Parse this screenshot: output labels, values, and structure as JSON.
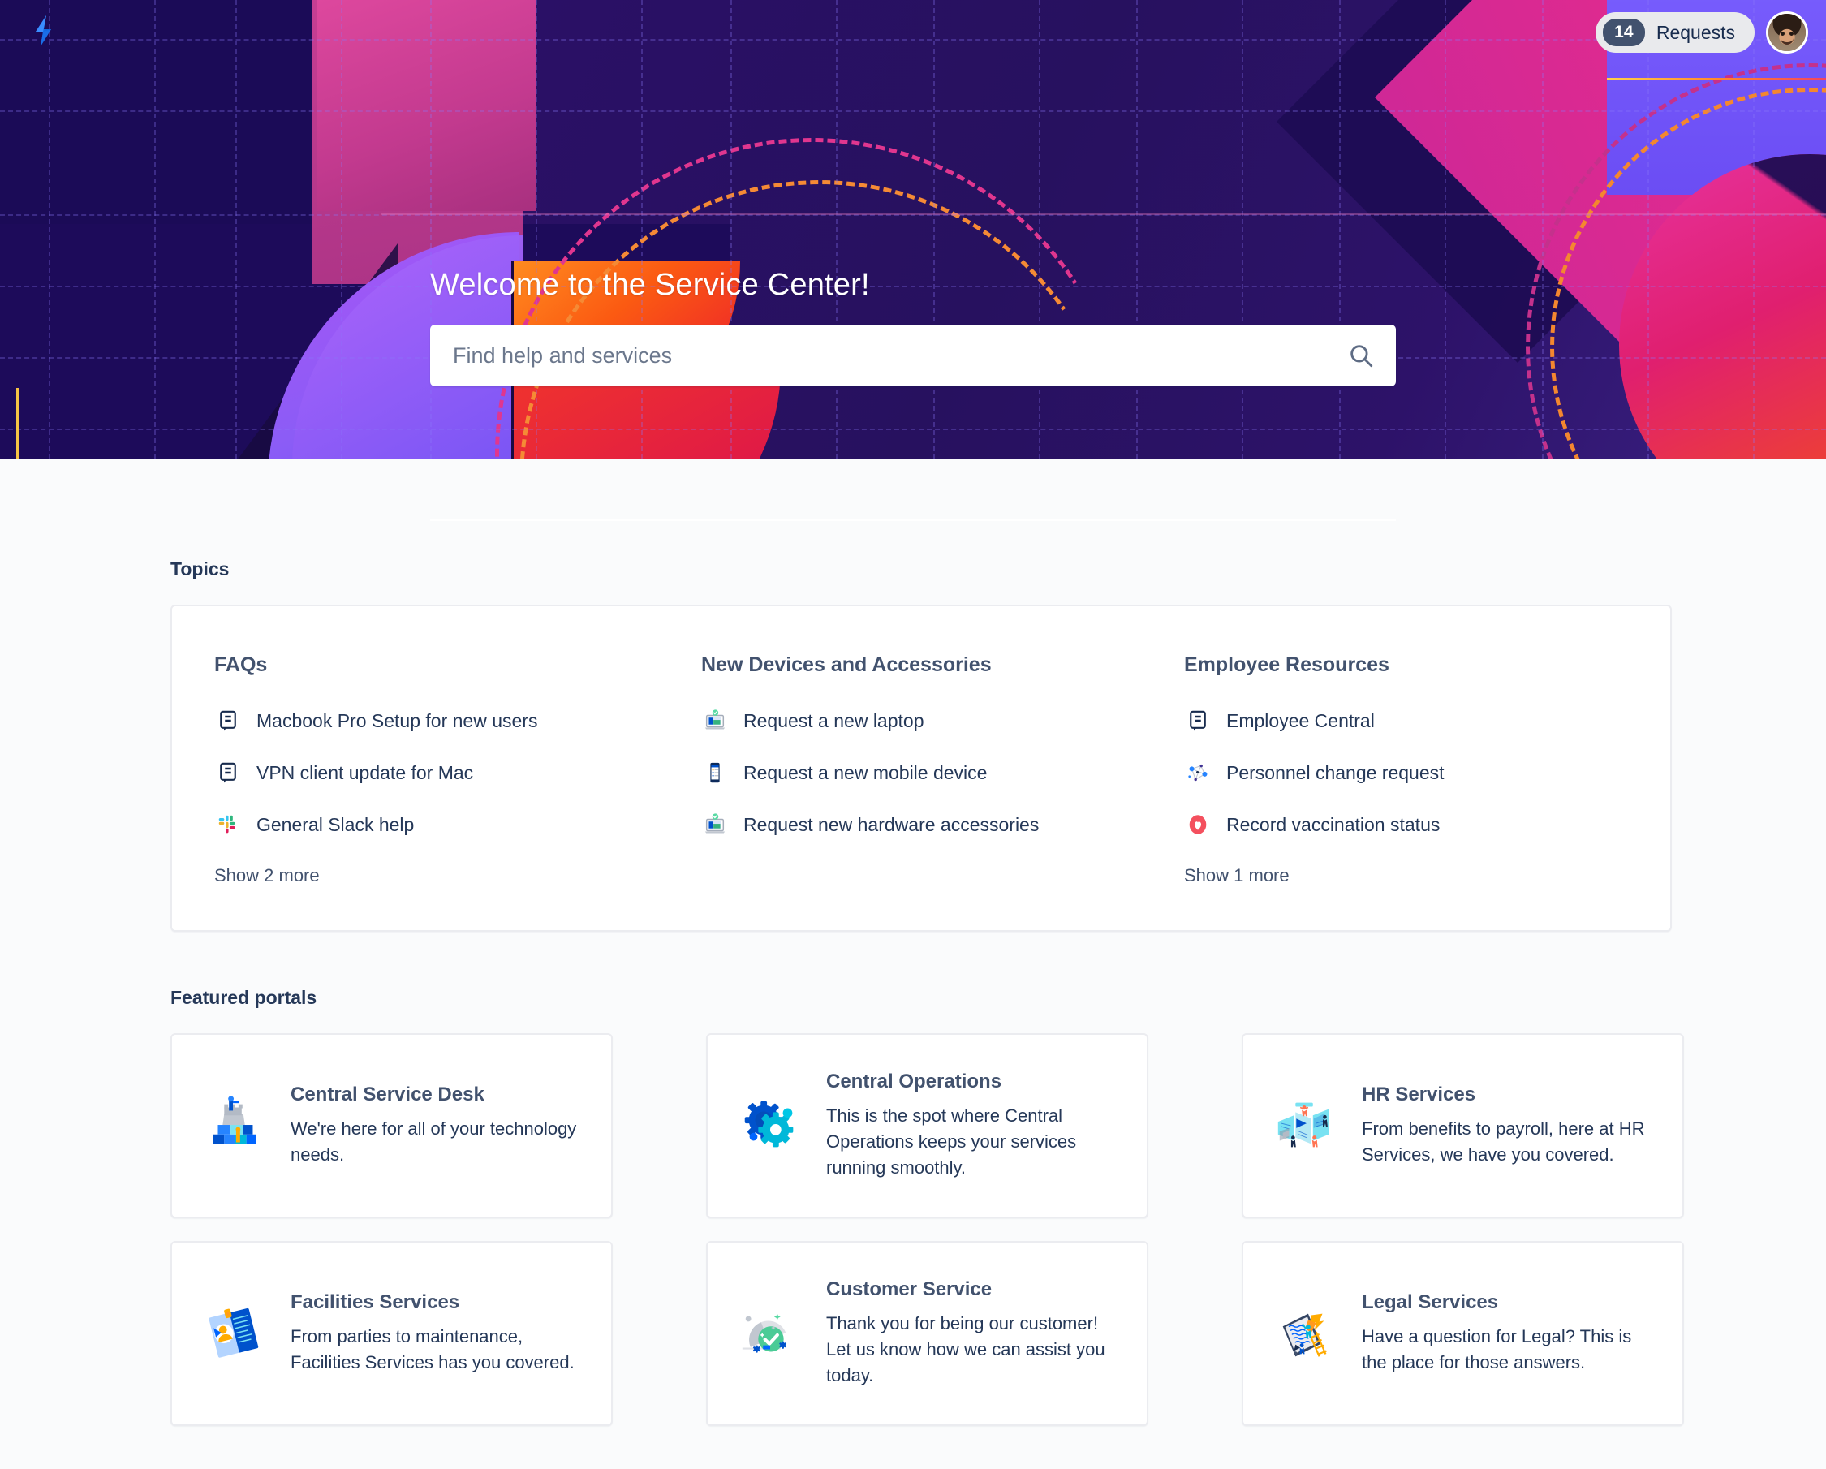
{
  "brand": {
    "logo_icon": "jira-service-management-bolt-icon",
    "logo_color": "#2684ff"
  },
  "topbar": {
    "requests_count": "14",
    "requests_label": "Requests",
    "avatar_icon": "user-avatar"
  },
  "hero": {
    "title": "Welcome to the Service Center!",
    "search_placeholder": "Find help and services",
    "search_value": "",
    "search_icon": "search-icon"
  },
  "topics": {
    "section_title": "Topics",
    "columns": [
      {
        "heading": "FAQs",
        "items": [
          {
            "label": "Macbook Pro Setup for new users",
            "icon": "knowledge-article-icon"
          },
          {
            "label": "VPN client update for Mac",
            "icon": "knowledge-article-icon"
          },
          {
            "label": "General Slack help",
            "icon": "slack-icon"
          }
        ],
        "show_more": "Show 2 more"
      },
      {
        "heading": "New Devices and Accessories",
        "items": [
          {
            "label": "Request a new laptop",
            "icon": "laptop-request-icon"
          },
          {
            "label": "Request a new mobile device",
            "icon": "mobile-device-icon"
          },
          {
            "label": "Request new hardware accessories",
            "icon": "laptop-request-icon"
          }
        ],
        "show_more": ""
      },
      {
        "heading": "Employee Resources",
        "items": [
          {
            "label": "Employee Central",
            "icon": "knowledge-article-icon"
          },
          {
            "label": "Personnel change request",
            "icon": "network-nodes-icon"
          },
          {
            "label": "Record vaccination status",
            "icon": "heart-shield-icon"
          }
        ],
        "show_more": "Show 1 more"
      }
    ]
  },
  "featured_portals": {
    "section_title": "Featured portals",
    "cards": [
      {
        "name": "Central Service Desk",
        "description": "We're here for all of your technology needs.",
        "illustration": "castle-blocks-illustration"
      },
      {
        "name": "Central Operations",
        "description": "This is the spot where Central Operations keeps your services running smoothly.",
        "illustration": "gears-illustration"
      },
      {
        "name": "HR Services",
        "description": "From benefits to payroll, here at HR Services, we have you covered.",
        "illustration": "people-panels-illustration"
      },
      {
        "name": "Facilities Services",
        "description": "From parties to maintenance, Facilities Services has you covered.",
        "illustration": "id-badge-illustration"
      },
      {
        "name": "Customer Service",
        "description": "Thank you for being our customer! Let us know how we can assist you today.",
        "illustration": "service-dome-check-illustration"
      },
      {
        "name": "Legal Services",
        "description": "Have a question for Legal? This is the place for those answers.",
        "illustration": "tablet-ladder-illustration"
      }
    ]
  },
  "colors": {
    "page_background": "#fafbfc",
    "card_background": "#ffffff",
    "card_border": "#ebecf0",
    "heading_text": "#253858",
    "body_text": "#253858",
    "muted_text": "#42526e",
    "accent_blue": "#0052cc",
    "hero_purple": "#2a1066",
    "hero_magenta": "#e0499f",
    "hero_orange": "#fb5a12",
    "vaccination_red": "#f4505e"
  }
}
